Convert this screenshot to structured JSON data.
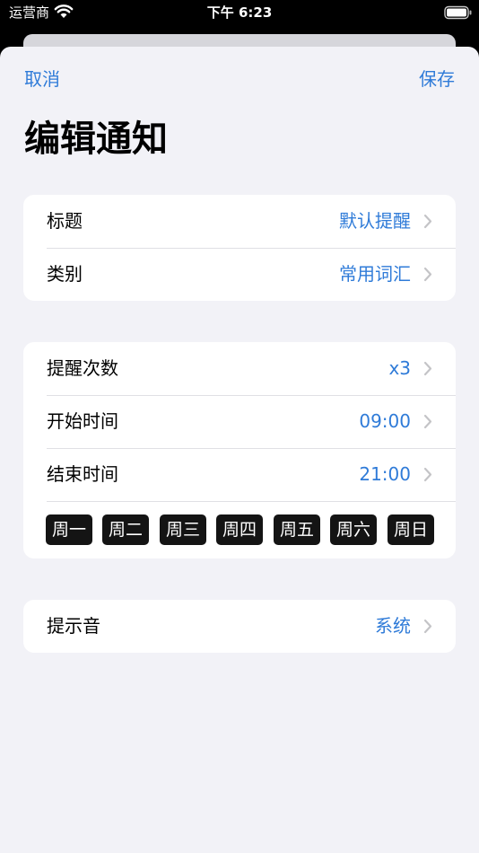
{
  "status_bar": {
    "carrier": "运营商",
    "time": "下午 6:23"
  },
  "nav": {
    "cancel_label": "取消",
    "save_label": "保存"
  },
  "title": "编辑通知",
  "section1": {
    "title_row": {
      "label": "标题",
      "value": "默认提醒"
    },
    "category_row": {
      "label": "类别",
      "value": "常用词汇"
    }
  },
  "section2": {
    "count_row": {
      "label": "提醒次数",
      "value": "x3"
    },
    "start_row": {
      "label": "开始时间",
      "value": "09:00"
    },
    "end_row": {
      "label": "结束时间",
      "value": "21:00"
    },
    "days": [
      "周一",
      "周二",
      "周三",
      "周四",
      "周五",
      "周六",
      "周日"
    ]
  },
  "section3": {
    "sound_row": {
      "label": "提示音",
      "value": "系统"
    }
  },
  "colors": {
    "accent": "#2f7bd8",
    "background": "#f2f2f7",
    "card": "#ffffff",
    "day_chip": "#141414"
  },
  "icons": [
    "wifi-icon",
    "battery-icon",
    "chevron-right-icon"
  ]
}
